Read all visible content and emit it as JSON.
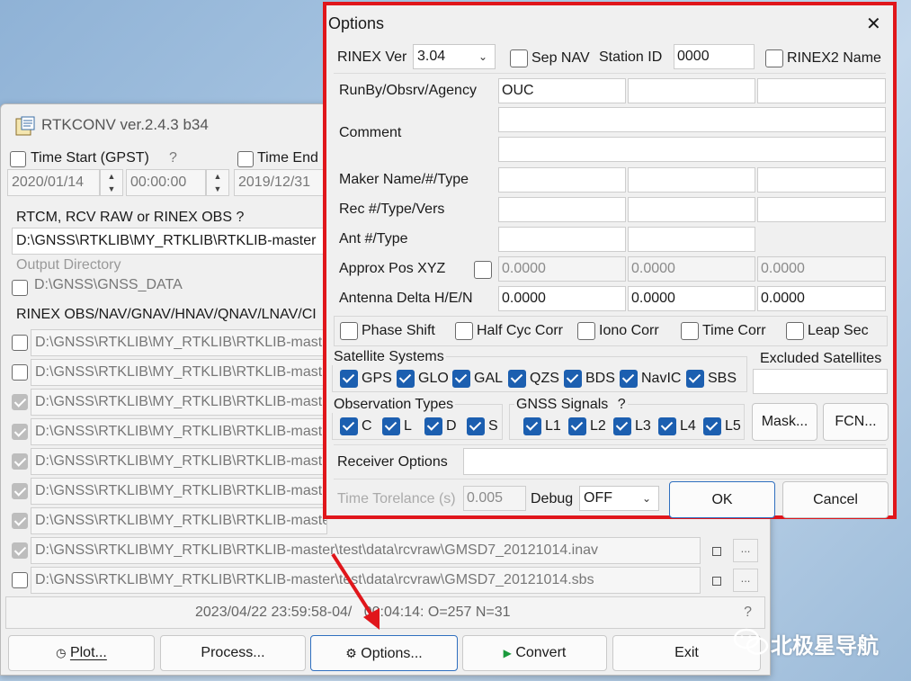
{
  "main": {
    "title": "RTKCONV ver.2.4.3 b34",
    "time_start_label": "Time Start (GPST)",
    "time_start_help": "?",
    "time_start_date": "2020/01/14",
    "time_start_time": "00:00:00",
    "time_end_label": "Time End",
    "time_end_date": "2019/12/31",
    "input_label": "RTCM, RCV RAW or RINEX OBS ?",
    "input_path": "D:\\GNSS\\RTKLIB\\MY_RTKLIB\\RTKLIB-master",
    "output_dir_label": "Output Directory",
    "output_dir_path": "D:\\GNSS\\GNSS_DATA",
    "rinex_label": "RINEX OBS/NAV/GNAV/HNAV/QNAV/LNAV/CI",
    "output_files": [
      {
        "path": "D:\\GNSS\\RTKLIB\\MY_RTKLIB\\RTKLIB-mast",
        "checked": false
      },
      {
        "path": "D:\\GNSS\\RTKLIB\\MY_RTKLIB\\RTKLIB-mast",
        "checked": false
      },
      {
        "path": "D:\\GNSS\\RTKLIB\\MY_RTKLIB\\RTKLIB-mast",
        "checked": true
      },
      {
        "path": "D:\\GNSS\\RTKLIB\\MY_RTKLIB\\RTKLIB-mast",
        "checked": true
      },
      {
        "path": "D:\\GNSS\\RTKLIB\\MY_RTKLIB\\RTKLIB-maste",
        "checked": true
      },
      {
        "path": "D:\\GNSS\\RTKLIB\\MY_RTKLIB\\RTKLIB-maste",
        "checked": true
      },
      {
        "path": "D:\\GNSS\\RTKLIB\\MY_RTKLIB\\RTKLIB-maste",
        "checked": true
      },
      {
        "path": "D:\\GNSS\\RTKLIB\\MY_RTKLIB\\RTKLIB-master\\test\\data\\rcvraw\\GMSD7_20121014.inav",
        "checked": true
      },
      {
        "path": "D:\\GNSS\\RTKLIB\\MY_RTKLIB\\RTKLIB-master\\test\\data\\rcvraw\\GMSD7_20121014.sbs",
        "checked": false
      }
    ],
    "row_button": "...",
    "status_text": "2023/04/22 23:59:58-04/   00:04:14: O=257 N=31",
    "status_help": "?",
    "buttons": {
      "plot": "Plot...",
      "process": "Process...",
      "options": "Options...",
      "convert": "Convert",
      "exit": "Exit"
    },
    "icons": {
      "plot": "◷",
      "options": "⚙",
      "convert": "▶"
    }
  },
  "options": {
    "title": "Options",
    "close": "✕",
    "rinex_ver_label": "RINEX Ver",
    "rinex_ver_value": "3.04",
    "sep_nav_label": "Sep NAV",
    "station_id_label": "Station ID",
    "station_id_value": "0000",
    "rinex2_name_label": "RINEX2 Name",
    "runby_label": "RunBy/Obsrv/Agency",
    "runby_values": [
      "OUC",
      "",
      ""
    ],
    "comment_label": "Comment",
    "comment_values": [
      "",
      ""
    ],
    "maker_label": "Maker Name/#/Type",
    "rec_label": "Rec #/Type/Vers",
    "ant_label": "Ant #/Type",
    "approx_label": "Approx Pos XYZ",
    "approx_values": [
      "0.0000",
      "0.0000",
      "0.0000"
    ],
    "antdelta_label": "Antenna Delta H/E/N",
    "antdelta_values": [
      "0.0000",
      "0.0000",
      "0.0000"
    ],
    "corrections": [
      "Phase Shift",
      "Half Cyc Corr",
      "Iono Corr",
      "Time Corr",
      "Leap Sec"
    ],
    "sat_systems_label": "Satellite Systems",
    "sat_systems": [
      "GPS",
      "GLO",
      "GAL",
      "QZS",
      "BDS",
      "NavIC",
      "SBS"
    ],
    "excluded_label": "Excluded Satellites",
    "obs_types_label": "Observation Types",
    "obs_types": [
      "C",
      "L",
      "D",
      "S"
    ],
    "gnss_signals_label": "GNSS Signals",
    "gnss_signals_help": "?",
    "gnss_signals": [
      "L1",
      "L2",
      "L3",
      "L4",
      "L5"
    ],
    "mask_button": "Mask...",
    "fcn_button": "FCN...",
    "receiver_options_label": "Receiver Options",
    "time_tol_label": "Time Torelance (s)",
    "time_tol_value": "0.005",
    "debug_label": "Debug",
    "debug_value": "OFF",
    "ok_button": "OK",
    "cancel_button": "Cancel"
  },
  "watermark": "北极星导航",
  "accent_color": "#1c5fb0",
  "highlight_color": "#e0161b"
}
